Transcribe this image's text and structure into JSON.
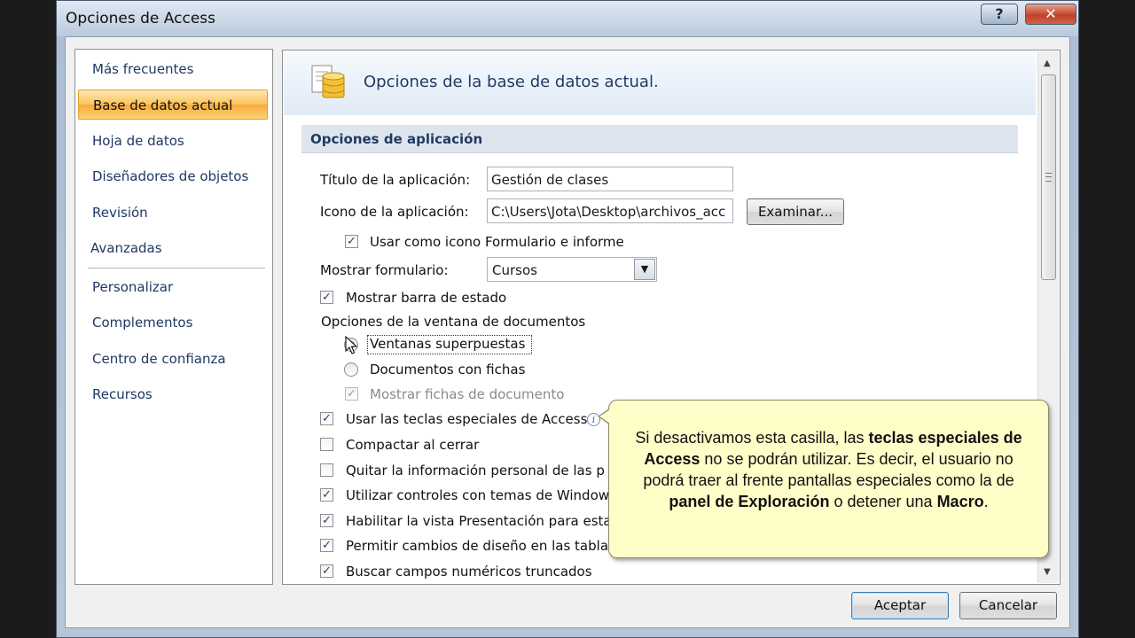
{
  "window": {
    "title": "Opciones de Access",
    "help": "?",
    "close": "✕"
  },
  "sidebar": {
    "items": [
      {
        "label": "Más frecuentes"
      },
      {
        "label": "Base de datos actual",
        "selected": true
      },
      {
        "label": "Hoja de datos"
      },
      {
        "label": "Diseñadores de objetos"
      },
      {
        "label": "Revisión"
      },
      {
        "label": "Avanzadas"
      },
      {
        "label": "Personalizar"
      },
      {
        "label": "Complementos"
      },
      {
        "label": "Centro de confianza"
      },
      {
        "label": "Recursos"
      }
    ]
  },
  "content": {
    "header": "Opciones de la base de datos actual.",
    "section_title": "Opciones de aplicación",
    "app_title_label": "Título de la aplicación:",
    "app_title_value": "Gestión de clases",
    "app_icon_label": "Icono de la aplicación:",
    "app_icon_value": "C:\\Users\\Jota\\Desktop\\archivos_acc",
    "browse_button": "Examinar...",
    "use_as_icon_label": "Usar como icono Formulario e informe",
    "show_form_label": "Mostrar formulario:",
    "show_form_value": "Cursos",
    "status_bar_label": "Mostrar barra de estado",
    "doc_window_options_label": "Opciones de la ventana de documentos",
    "overlapping_windows_label": "Ventanas superpuestas",
    "tabbed_docs_label": "Documentos con fichas",
    "show_doc_tabs_label": "Mostrar fichas de documento",
    "special_keys_label": "Usar las teclas especiales de Access",
    "compact_on_close_label": "Compactar al cerrar",
    "remove_personal_info_label": "Quitar la información personal de las p",
    "themed_controls_label": "Utilizar controles con temas de Window",
    "layout_view_label": "Habilitar la vista Presentación para esta",
    "design_changes_label": "Permitir cambios de diseño en las tabla",
    "truncated_fields_label": "Buscar campos numéricos truncados"
  },
  "checkboxes": {
    "use_as_icon": true,
    "status_bar": true,
    "show_doc_tabs": true,
    "special_keys": true,
    "compact_on_close": false,
    "remove_personal_info": false,
    "themed_controls": true,
    "layout_view": true,
    "design_changes": true,
    "truncated_fields": true
  },
  "radio_selected": "overlapping_windows",
  "callout": {
    "t1": "Si desactivamos esta casilla, las ",
    "b1": "teclas especiales de Access",
    "t2": " no se podrán utilizar. Es decir, el usuario no podrá traer al frente pantallas especiales como la de ",
    "b2": "panel de Exploración",
    "t3": " o detener una ",
    "b3": "Macro",
    "t4": "."
  },
  "footer": {
    "ok_button": "Aceptar",
    "cancel_button": "Cancelar"
  },
  "colors": {
    "selected_nav": "#fbc45b",
    "callout_bg": "#fffdc8",
    "nav_text": "#1e3964"
  }
}
